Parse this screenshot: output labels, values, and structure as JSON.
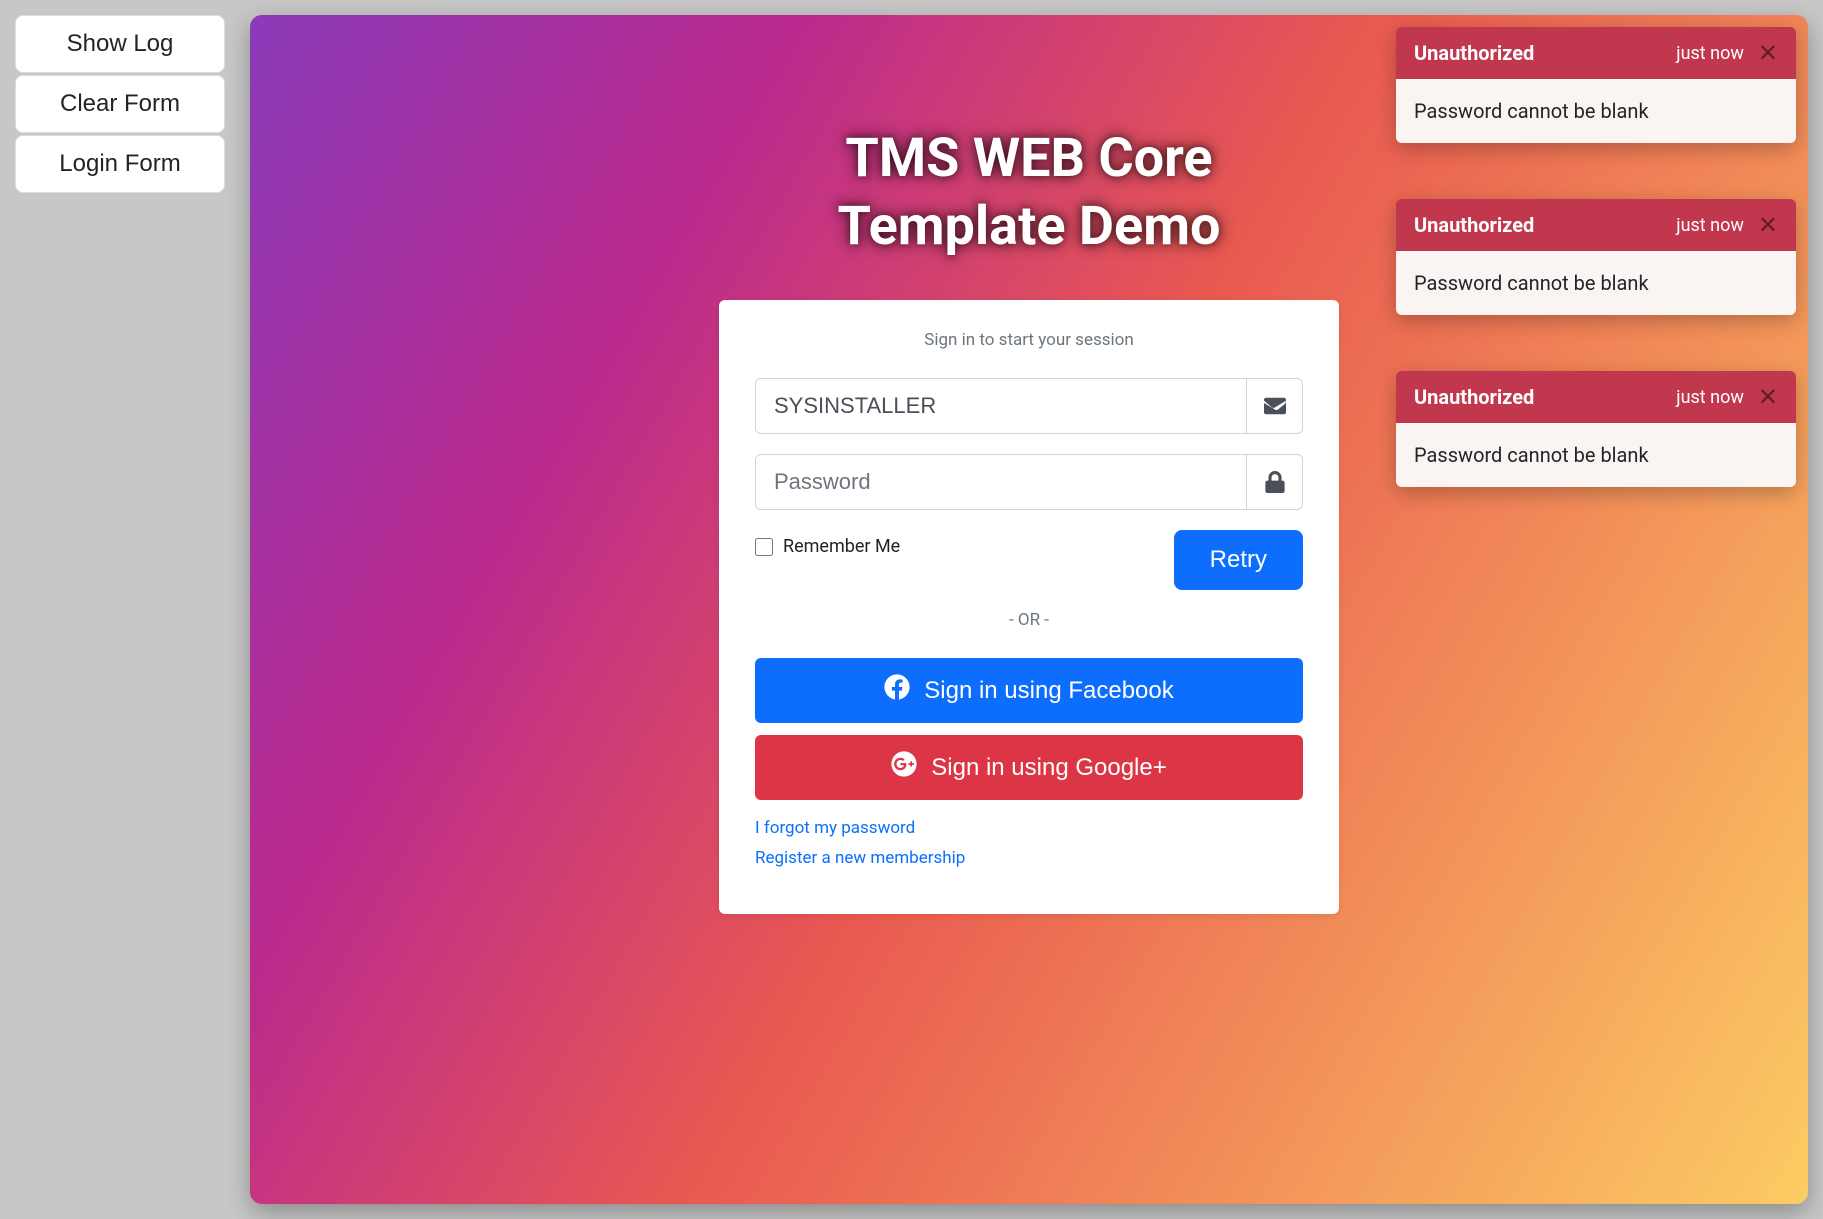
{
  "sidebar": {
    "show_log": "Show Log",
    "clear_form": "Clear Form",
    "login_form": "Login Form"
  },
  "header": {
    "title_line1": "TMS WEB Core",
    "title_line2": "Template Demo"
  },
  "login": {
    "prompt": "Sign in to start your session",
    "username_value": "SYSINSTALLER",
    "password_placeholder": "Password",
    "remember_label": "Remember Me",
    "retry_label": "Retry",
    "or_label": "- OR -",
    "facebook_label": "Sign in using Facebook",
    "google_label": "Sign in using Google+",
    "forgot_link": "I forgot my password",
    "register_link": "Register a new membership"
  },
  "toasts": [
    {
      "title": "Unauthorized",
      "time": "just now",
      "body": "Password cannot be blank"
    },
    {
      "title": "Unauthorized",
      "time": "just now",
      "body": "Password cannot be blank"
    },
    {
      "title": "Unauthorized",
      "time": "just now",
      "body": "Password cannot be blank"
    }
  ],
  "colors": {
    "primary": "#0d6efd",
    "danger": "#dc3545",
    "toast_header": "#c1384e"
  }
}
